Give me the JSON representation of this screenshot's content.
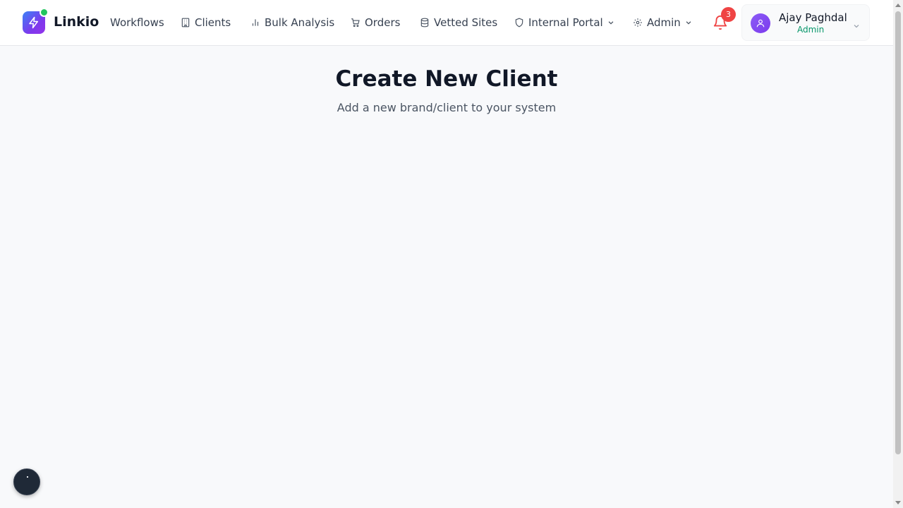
{
  "header": {
    "brand": "Linkio",
    "nav": [
      {
        "label": "Workflows",
        "icon": "none"
      },
      {
        "label": "Clients",
        "icon": "building-icon"
      },
      {
        "label": "Bulk Analysis",
        "icon": "bar-chart-icon"
      },
      {
        "label": "Orders",
        "icon": "cart-icon"
      },
      {
        "label": "Vetted Sites",
        "icon": "database-icon"
      },
      {
        "label": "Internal Portal",
        "icon": "shield-icon",
        "dropdown": true
      },
      {
        "label": "Admin",
        "icon": "gear-icon",
        "dropdown": true
      }
    ],
    "notifications": {
      "count": "3"
    },
    "user": {
      "name": "Ajay Paghdal",
      "role": "Admin"
    }
  },
  "main": {
    "title": "Create New Client",
    "subtitle": "Add a new brand/client to your system"
  },
  "colors": {
    "accent": "#7c3aed",
    "online": "#22c55e",
    "badge": "#ef4444",
    "role": "#059669",
    "background": "#f8f9fb"
  }
}
